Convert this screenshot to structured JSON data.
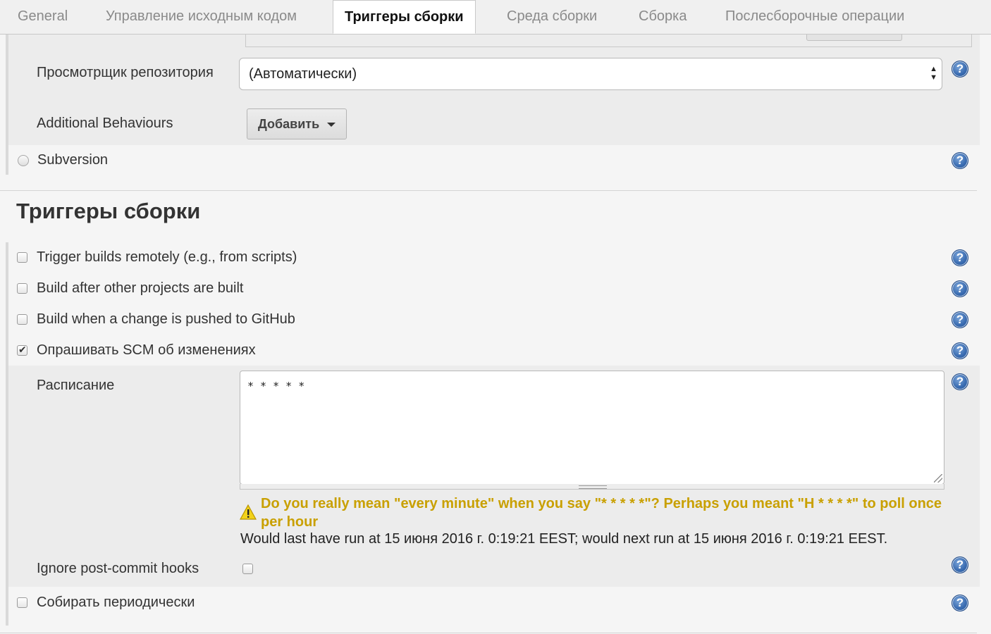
{
  "tabs": [
    {
      "label": "General"
    },
    {
      "label": "Управление исходным кодом"
    },
    {
      "label": "Триггеры сборки"
    },
    {
      "label": "Среда сборки"
    },
    {
      "label": "Сборка"
    },
    {
      "label": "Послесборочные операции"
    }
  ],
  "active_tab": "Триггеры сборки",
  "scm": {
    "repo_browser_label": "Просмотрщик репозитория",
    "repo_browser_value": "(Автоматически)",
    "additional_behaviours_label": "Additional Behaviours",
    "add_button_label": "Добавить",
    "subversion_label": "Subversion"
  },
  "triggers": {
    "section_title": "Триггеры сборки",
    "items": [
      {
        "label": "Trigger builds remotely (e.g., from scripts)",
        "checked": false
      },
      {
        "label": "Build after other projects are built",
        "checked": false
      },
      {
        "label": "Build when a change is pushed to GitHub",
        "checked": false
      },
      {
        "label": "Опрашивать SCM об изменениях",
        "checked": true
      }
    ],
    "schedule_label": "Расписание",
    "schedule_value": "* * * * *",
    "warning": "Do you really mean \"every minute\" when you say \"* * * * *\"? Perhaps you meant \"H * * * *\" to poll once per hour",
    "info": "Would last have run at 15 июня 2016 г. 0:19:21 EEST; would next run at 15 июня 2016 г. 0:19:21 EEST.",
    "ignore_hooks_label": "Ignore post-commit hooks",
    "ignore_hooks_checked": false,
    "periodic_label": "Собирать периодически",
    "periodic_checked": false
  },
  "help_glyph": "?",
  "colors": {
    "warning": "#c9a000",
    "help_icon": "#3b6db2",
    "panel": "#ececec"
  }
}
